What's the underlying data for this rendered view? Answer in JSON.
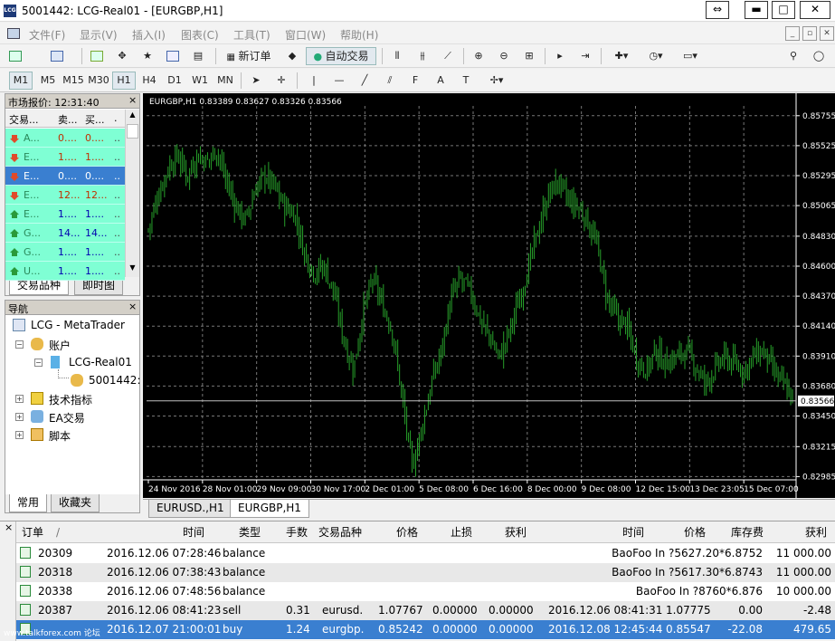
{
  "window": {
    "title": "5001442: LCG-Real01 - [EURGBP,H1]",
    "logo": "LCG"
  },
  "menu": [
    "文件(F)",
    "显示(V)",
    "插入(I)",
    "图表(C)",
    "工具(T)",
    "窗口(W)",
    "帮助(H)"
  ],
  "toolbar": {
    "new_order": "新订单",
    "auto_trade": "自动交易"
  },
  "timeframes": [
    "M1",
    "M5",
    "M15",
    "M30",
    "H1",
    "H4",
    "D1",
    "W1",
    "MN"
  ],
  "market_watch": {
    "title": "市场报价: 12:31:40",
    "columns": [
      "交易...",
      "卖...",
      "买...",
      "."
    ],
    "rows": [
      {
        "symbol": "A...",
        "bid": "0....",
        "ask": "0....",
        "extra": "..",
        "dir": "down"
      },
      {
        "symbol": "E...",
        "bid": "1....",
        "ask": "1....",
        "extra": "..",
        "dir": "down"
      },
      {
        "symbol": "E...",
        "bid": "0....",
        "ask": "0....",
        "extra": "..",
        "dir": "down"
      },
      {
        "symbol": "E...",
        "bid": "12...",
        "ask": "12...",
        "extra": "..",
        "dir": "down"
      },
      {
        "symbol": "E...",
        "bid": "1....",
        "ask": "1....",
        "extra": "..",
        "dir": "up"
      },
      {
        "symbol": "G...",
        "bid": "14...",
        "ask": "14...",
        "extra": "..",
        "dir": "up"
      },
      {
        "symbol": "G...",
        "bid": "1....",
        "ask": "1....",
        "extra": "..",
        "dir": "up"
      },
      {
        "symbol": "U...",
        "bid": "1....",
        "ask": "1....",
        "extra": "..",
        "dir": "up"
      }
    ],
    "tabs": [
      "交易品种",
      "即时图"
    ]
  },
  "navigator": {
    "title": "导航",
    "items": [
      "LCG - MetaTrader",
      "账户",
      "LCG-Real01",
      "5001442:",
      "技术指标",
      "EA交易",
      "脚本"
    ],
    "tabs": [
      "常用",
      "收藏夹"
    ]
  },
  "chart": {
    "info": "EURGBP,H1  0.83389 0.83627 0.83326 0.83566",
    "current_price": "0.83566",
    "tabs": [
      "EURUSD.,H1",
      "EURGBP,H1"
    ]
  },
  "chart_data": {
    "type": "bar",
    "title": "EURGBP,H1",
    "ylim": [
      0.8296,
      0.8583
    ],
    "yticks": [
      "0.85755",
      "0.85525",
      "0.85295",
      "0.85065",
      "0.84830",
      "0.84600",
      "0.84370",
      "0.84140",
      "0.83910",
      "0.83680",
      "0.83450",
      "0.83215",
      "0.82985"
    ],
    "xticks": [
      "24 Nov 2016",
      "28 Nov 01:00",
      "29 Nov 09:00",
      "30 Nov 17:00",
      "2 Dec 01:00",
      "5 Dec 08:00",
      "6 Dec 16:00",
      "8 Dec 00:00",
      "9 Dec 08:00",
      "12 Dec 15:00",
      "13 Dec 23:05",
      "15 Dec 07:00"
    ],
    "close_path": [
      0.8488,
      0.8515,
      0.8535,
      0.8545,
      0.853,
      0.8545,
      0.854,
      0.855,
      0.8525,
      0.8505,
      0.8495,
      0.852,
      0.853,
      0.852,
      0.8505,
      0.85,
      0.847,
      0.8455,
      0.846,
      0.844,
      0.8405,
      0.838,
      0.8425,
      0.845,
      0.843,
      0.841,
      0.836,
      0.8305,
      0.8335,
      0.837,
      0.8395,
      0.8435,
      0.845,
      0.844,
      0.842,
      0.8405,
      0.839,
      0.841,
      0.8435,
      0.846,
      0.849,
      0.8515,
      0.8525,
      0.851,
      0.8505,
      0.8495,
      0.8475,
      0.8435,
      0.842,
      0.8415,
      0.839,
      0.838,
      0.8395,
      0.8385,
      0.839,
      0.8395,
      0.8385,
      0.837,
      0.838,
      0.839,
      0.8385,
      0.838,
      0.839,
      0.8395,
      0.838,
      0.837,
      0.836
    ],
    "current": 0.83566
  },
  "terminal": {
    "columns": [
      "订单",
      "/",
      "时间",
      "类型",
      "手数",
      "交易品种",
      "价格",
      "止损",
      "获利",
      "时间",
      "价格",
      "库存费",
      "获利"
    ],
    "rows": [
      {
        "order": "20309",
        "time": "2016.12.06 07:28:46",
        "type": "balance",
        "comment": "BaoFoo In ?5627.20*6.8752",
        "profit": "11 000.00"
      },
      {
        "order": "20318",
        "time": "2016.12.06 07:38:43",
        "type": "balance",
        "comment": "BaoFoo In ?5617.30*6.8743",
        "profit": "11 000.00"
      },
      {
        "order": "20338",
        "time": "2016.12.06 07:48:56",
        "type": "balance",
        "comment": "BaoFoo In ?8760*6.876",
        "profit": "10 000.00"
      },
      {
        "order": "20387",
        "time": "2016.12.06 08:41:23",
        "type": "sell",
        "lots": "0.31",
        "symbol": "eurusd.",
        "price": "1.07767",
        "sl": "0.00000",
        "tp": "0.00000",
        "ctime": "2016.12.06 08:41:31",
        "cprice": "1.07775",
        "swap": "0.00",
        "profit": "-2.48"
      },
      {
        "order": "",
        "time": "2016.12.07 21:00:01",
        "type": "buy",
        "lots": "1.24",
        "symbol": "eurgbp.",
        "price": "0.85242",
        "sl": "0.00000",
        "tp": "0.00000",
        "ctime": "2016.12.08 12:45:44",
        "cprice": "0.85547",
        "swap": "-22.08",
        "profit": "479.65"
      }
    ],
    "watermark": "www.talkforex.com 论坛"
  },
  "colors": {
    "grid": "#777",
    "candle": "#27a02a",
    "price_line": "#bfbfbf",
    "select": "#3a7fd0",
    "mw_row": "#7fffd4"
  }
}
